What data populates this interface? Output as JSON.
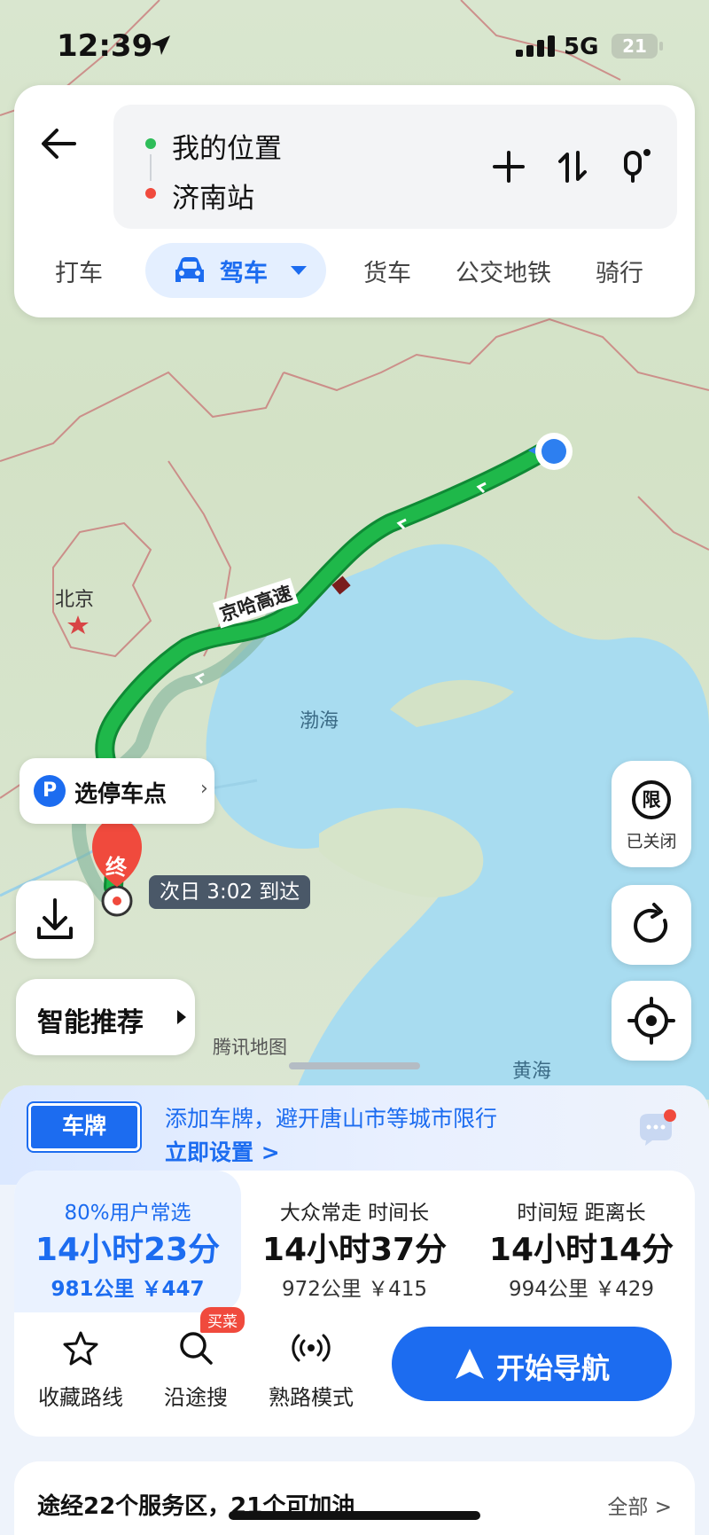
{
  "status_bar": {
    "time": "12:39",
    "network": "5G",
    "battery": "21"
  },
  "route": {
    "origin": "我的位置",
    "destination": "济南站"
  },
  "modes": {
    "taxi": "打车",
    "drive": "驾车",
    "truck": "货车",
    "transit": "公交地铁",
    "bike": "骑行"
  },
  "map": {
    "labels": {
      "beijing": "北京",
      "bohai": "渤海",
      "huanghai": "黄海",
      "provider": "腾讯地图",
      "road": "京哈高速"
    },
    "parking_label": "选停车点",
    "parking_icon": "P",
    "end_marker": "终",
    "arrival": "次日 3:02 到达",
    "smart_recommend": "智能推荐",
    "limit_label": "已关闭",
    "limit_icon_text": "限",
    "route_color": "#1fb84a"
  },
  "plate": {
    "badge": "车牌",
    "message": "添加车牌，避开唐山市等城市限行",
    "link": "立即设置 >"
  },
  "routes": [
    {
      "tag": "80%用户常选",
      "duration": "14小时23分",
      "meta": "981公里 ￥447"
    },
    {
      "tag": "大众常走 时间长",
      "duration": "14小时37分",
      "meta": "972公里 ￥415"
    },
    {
      "tag": "时间短 距离长",
      "duration": "14小时14分",
      "meta": "994公里 ￥429"
    }
  ],
  "actions": {
    "favorite": "收藏路线",
    "search": "沿途搜",
    "search_badge": "买菜",
    "familiar": "熟路模式",
    "start_nav": "开始导航"
  },
  "service": {
    "summary": "途经22个服务区，21个可加油",
    "all": "全部 >"
  },
  "colors": {
    "accent": "#1c6cf0",
    "route_green": "#1fb84a",
    "alert_red": "#f04a3d"
  }
}
